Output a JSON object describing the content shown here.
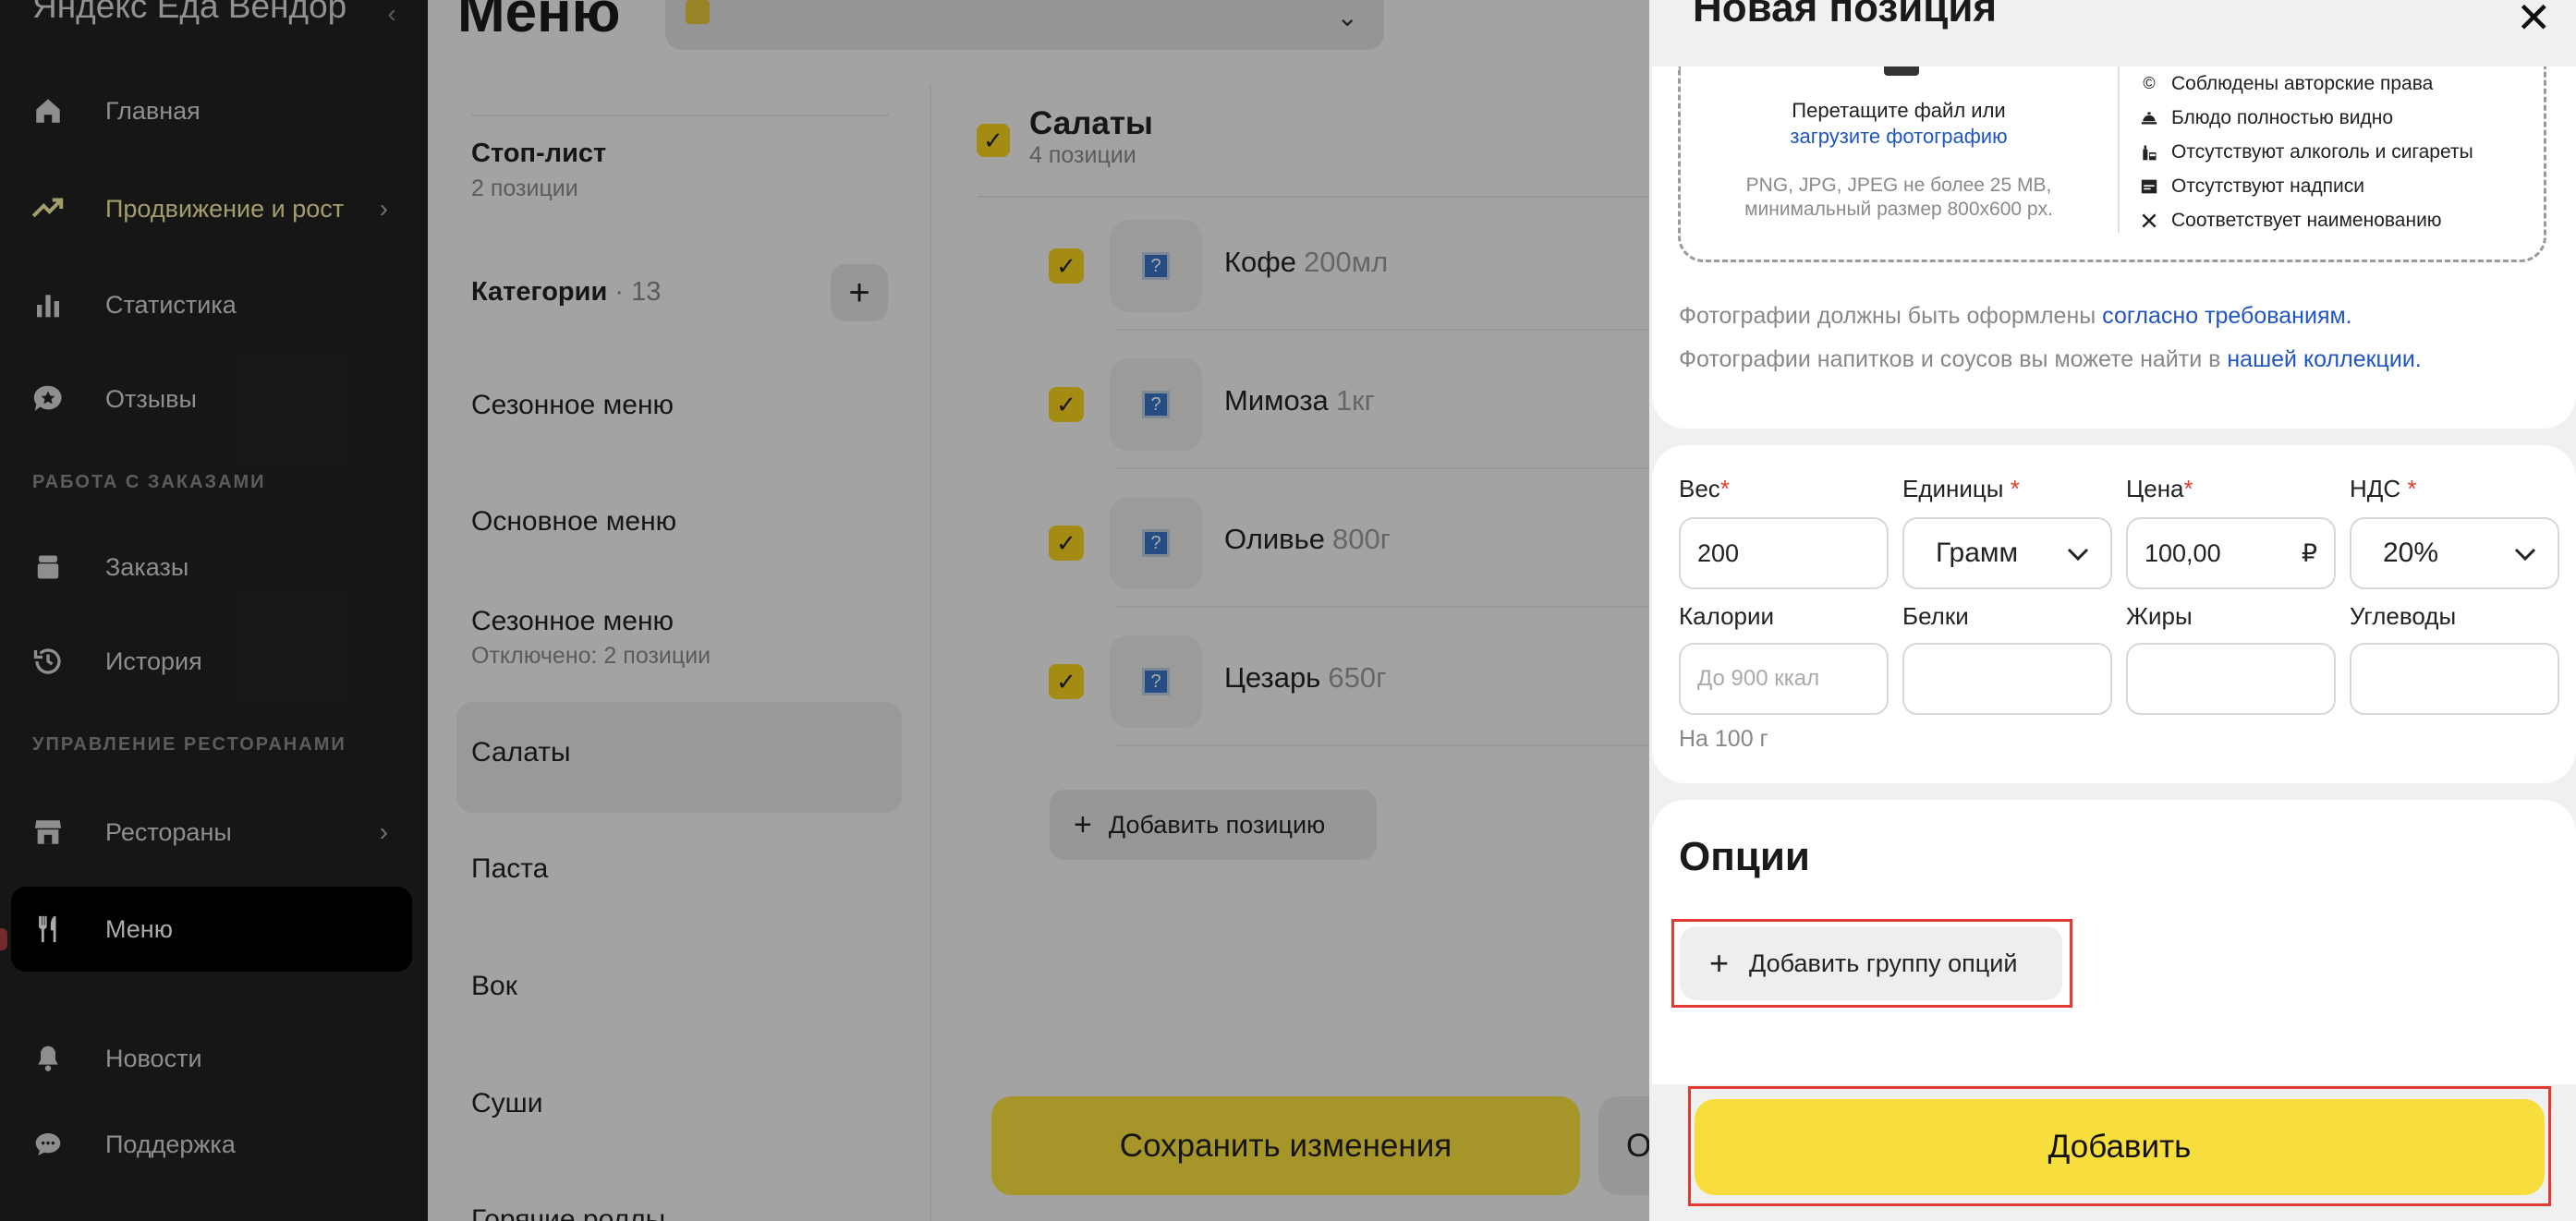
{
  "sidebar": {
    "brand": "Яндекс Еда Вендор",
    "collapse_icon": "chevron-left-icon",
    "items": [
      {
        "label": "Главная",
        "icon": "home-icon"
      },
      {
        "label": "Продвижение и рост",
        "icon": "trend-up-icon"
      },
      {
        "label": "Статистика",
        "icon": "bar-chart-icon"
      },
      {
        "label": "Отзывы",
        "icon": "review-icon"
      },
      {
        "label": "Заказы",
        "icon": "orders-icon"
      },
      {
        "label": "История",
        "icon": "history-icon"
      },
      {
        "label": "Рестораны",
        "icon": "store-icon"
      },
      {
        "label": "Меню",
        "icon": "fork-knife-icon"
      },
      {
        "label": "Новости",
        "icon": "bell-icon"
      },
      {
        "label": "Поддержка",
        "icon": "chat-icon"
      }
    ],
    "sections": {
      "orders": "РАБОТА С ЗАКАЗАМИ",
      "restaurants": "УПРАВЛЕНИЕ РЕСТОРАНАМИ"
    }
  },
  "header": {
    "title": "Меню"
  },
  "categories": {
    "stoplist_title": "Стоп-лист",
    "stoplist_sub": "2 позиции",
    "title": "Категории",
    "count": "· 13",
    "add_label": "+",
    "items": [
      {
        "label": "Сезонное меню",
        "sub": ""
      },
      {
        "label": "Основное меню",
        "sub": ""
      },
      {
        "label": "Сезонное меню",
        "sub": "Отключено: 2 позиции"
      },
      {
        "label": "Салаты",
        "sub": ""
      },
      {
        "label": "Паста",
        "sub": ""
      },
      {
        "label": "Вок",
        "sub": ""
      },
      {
        "label": "Суши",
        "sub": ""
      },
      {
        "label": "Горячие роллы",
        "sub": ""
      }
    ]
  },
  "items_panel": {
    "title": "Салаты",
    "subtitle": "4 позиции",
    "check": "✓",
    "rows": [
      {
        "name": "Кофе",
        "weight": "200мл"
      },
      {
        "name": "Мимоза",
        "weight": "1кг"
      },
      {
        "name": "Оливье",
        "weight": "800г"
      },
      {
        "name": "Цезарь",
        "weight": "650г"
      }
    ],
    "add_position_label": "Добавить позицию",
    "save_label": "Сохранить изменения",
    "cancel_label": "О"
  },
  "drawer": {
    "title": "Новая позиция",
    "close": "✕",
    "upload": {
      "main": "Перетащите файл или",
      "link": "загрузите фотографию",
      "hint1": "PNG, JPG, JPEG не более 25 MB,",
      "hint2": "минимальный размер 800x600 px."
    },
    "requirements": [
      {
        "label": "Соблюдены авторские права",
        "icon": "copyright-icon"
      },
      {
        "label": "Блюдо полностью видно",
        "icon": "dish-icon"
      },
      {
        "label": "Отсутствуют алкоголь и сигареты",
        "icon": "no-alcohol-icon"
      },
      {
        "label": "Отсутствуют надписи",
        "icon": "no-text-icon"
      },
      {
        "label": "Соответствует наименованию",
        "icon": "utensils-icon"
      }
    ],
    "note1_text": "Фотографии должны быть оформлены ",
    "note1_link": "согласно требованиям.",
    "note2_text": "Фотографии напитков и соусов вы можете найти в ",
    "note2_link": "нашей коллекции.",
    "fields": {
      "weight_label": "Вес",
      "weight_value": "200",
      "unit_label": "Единицы",
      "unit_value": "Грамм",
      "price_label": "Цена",
      "price_value": "100,00",
      "price_suffix": "₽",
      "vat_label": "НДС",
      "vat_value": "20%",
      "calories_label": "Калории",
      "calories_placeholder": "До 900 ккал",
      "protein_label": "Белки",
      "fat_label": "Жиры",
      "carbs_label": "Углеводы",
      "per_100": "На 100 г",
      "required_mark": "*"
    },
    "options_title": "Опции",
    "add_group_label": "Добавить группу опций",
    "submit_label": "Добавить"
  },
  "colors": {
    "accent_yellow": "#f8de3c",
    "link_blue": "#1f55c4",
    "highlight_red": "#e23a32",
    "sidebar_bg": "#222222"
  }
}
